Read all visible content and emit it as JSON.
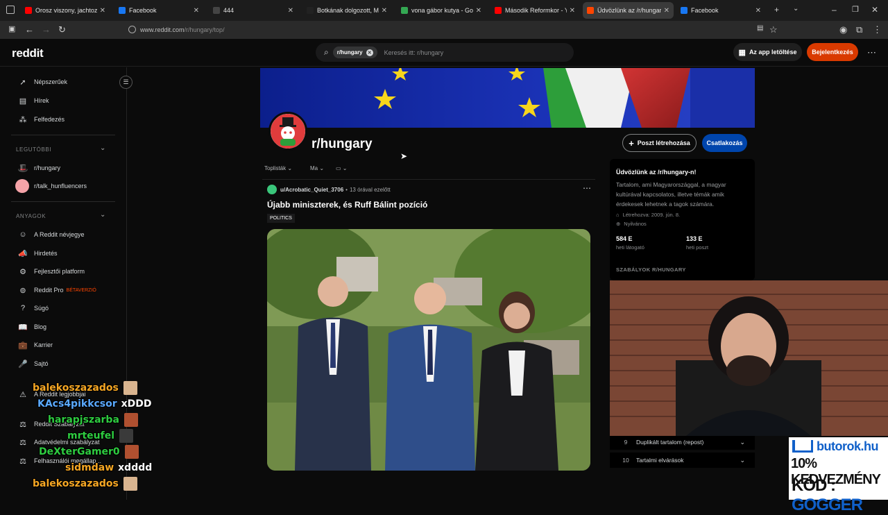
{
  "browser": {
    "tabs": [
      {
        "title": "Orosz viszony, jachtozás, g",
        "favicon_color": "#ff0000"
      },
      {
        "title": "Facebook",
        "favicon_color": "#1877f2"
      },
      {
        "title": "444",
        "favicon_color": "#444444"
      },
      {
        "title": "Botkának dolgozott, Márki",
        "favicon_color": "#222222"
      },
      {
        "title": "vona gábor kutya - Google",
        "favicon_color": "#34a853"
      },
      {
        "title": "Második Reformkor - YouTu",
        "favicon_color": "#ff0000"
      },
      {
        "title": "Üdvözlünk az /r/hungary-n!",
        "favicon_color": "#ff4500"
      },
      {
        "title": "Facebook",
        "favicon_color": "#1877f2"
      }
    ],
    "url_host": "www.reddit.com",
    "url_path": "/r/hungary/top/"
  },
  "header": {
    "logo": "reddit",
    "search_chip": "r/hungary",
    "search_placeholder": "Keresés itt: r/hungary",
    "app_button": "Az app letöltése",
    "login_button": "Bejelentkezés"
  },
  "sidebar": {
    "main_items": [
      {
        "label": "Népszerűek",
        "icon": "trending-icon"
      },
      {
        "label": "Hírek",
        "icon": "news-icon"
      },
      {
        "label": "Felfedezés",
        "icon": "explore-icon"
      }
    ],
    "recent_header": "LEGUTÓBBI",
    "recent_items": [
      {
        "label": "r/hungary"
      },
      {
        "label": "r/talk_hunfluencers"
      }
    ],
    "resources_header": "ANYAGOK",
    "resource_items": [
      {
        "label": "A Reddit névjegye"
      },
      {
        "label": "Hirdetés"
      },
      {
        "label": "Fejlesztői platform"
      },
      {
        "label": "Reddit Pro",
        "badge": "BÉTAVERZIÓ"
      },
      {
        "label": "Súgó"
      },
      {
        "label": "Blog"
      },
      {
        "label": "Karrier"
      },
      {
        "label": "Sajtó"
      }
    ],
    "lower_items": [
      {
        "label": "A Reddit legjobbjai"
      },
      {
        "label": "Reddit Szabályzat"
      },
      {
        "label": "Adatvédelmi szabályzat"
      },
      {
        "label": "Felhasználói megállap..."
      }
    ]
  },
  "subreddit": {
    "name": "r/hungary",
    "create_post": "Poszt létrehozása",
    "join": "Csatlakozás",
    "sort_top": "Toplisták",
    "sort_time": "Ma"
  },
  "post": {
    "author": "u/Acrobatic_Quiet_3706",
    "time": "13 órával ezelőtt",
    "title": "Újabb miniszterek, és Ruff Bálint pozíció",
    "flair": "POLITICS"
  },
  "about": {
    "title": "Üdvözlünk az /r/hungary-n!",
    "description": "Tartalom, ami Magyarországgal, a magyar kultúrával kapcsolatos, illetve témák amik érdekesek lehetnek a tagok számára.",
    "created": "Létrehozva: 2009. jún. 8.",
    "visibility": "Nyilvános",
    "visitors_value": "584 E",
    "visitors_label": "heti látogató",
    "posts_value": "133 E",
    "posts_label": "heti poszt",
    "rules_header": "SZABÁLYOK R/HUNGARY"
  },
  "rules": [
    {
      "num": "9",
      "text": "Duplikált tartalom (repost)"
    },
    {
      "num": "10",
      "text": "Tartalmi elvárások"
    }
  ],
  "chat": [
    {
      "user": "balekoszazados",
      "color": "#f5a623",
      "message": ""
    },
    {
      "user": "KAcs4pikkcsor",
      "color": "#5aa9ff",
      "message": "xDDD"
    },
    {
      "user": "harapjszarba",
      "color": "#2ecc40",
      "message": ""
    },
    {
      "user": "mrteufel",
      "color": "#2ecc40",
      "message": ""
    },
    {
      "user": "DeXterGamer0",
      "color": "#2ecc40",
      "message": ""
    },
    {
      "user": "sidmdaw",
      "color": "#f5a623",
      "message": "xdddd"
    },
    {
      "user": "balekoszazados",
      "color": "#f5a623",
      "message": ""
    }
  ],
  "ad": {
    "brand": "butorok.hu",
    "line1": "10% KEDVEZMÉNY",
    "line2_label": "KÓD : ",
    "line2_code": "GOGGER"
  }
}
